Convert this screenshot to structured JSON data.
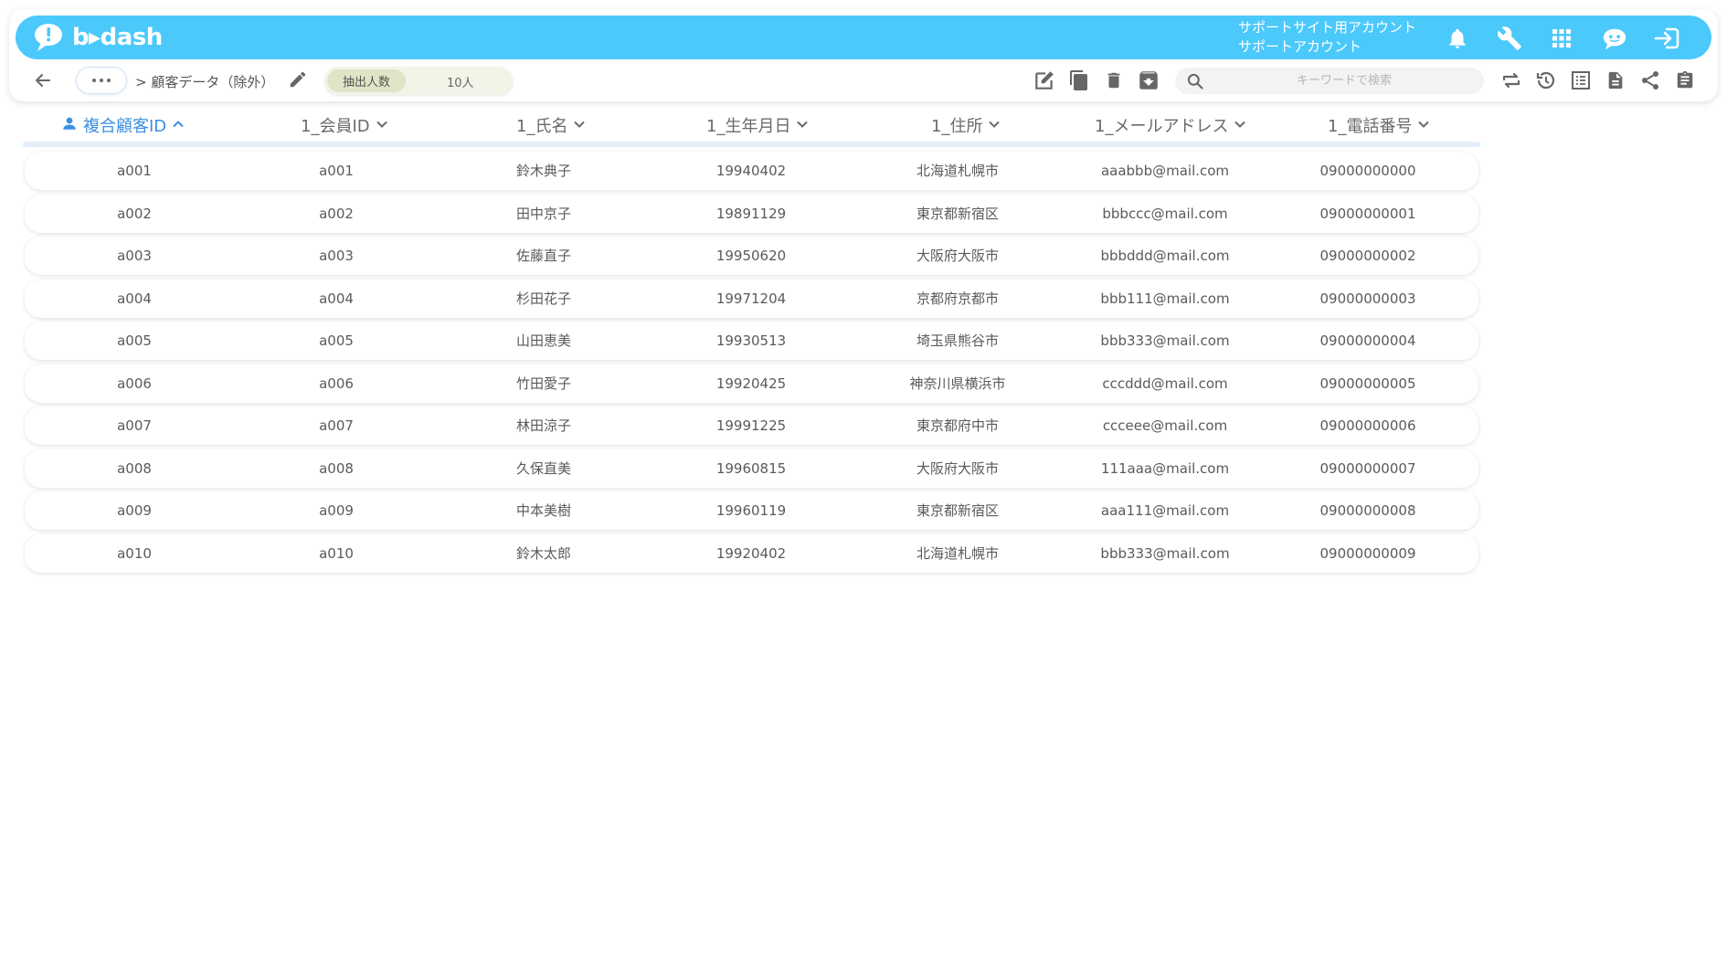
{
  "app": {
    "logo_text": "b▸dash",
    "account_line1": "サポートサイト用アカウント",
    "account_line2": "サポートアカウント",
    "brand_color": "#4cc9fb",
    "accent_color": "#3b8fe0"
  },
  "top_icons": [
    "bell-icon",
    "wrench-icon",
    "apps-grid-icon",
    "chat-bot-icon",
    "logout-icon"
  ],
  "breadcrumb": {
    "separator": ">",
    "current": "顧客データ（除外）"
  },
  "count": {
    "label": "抽出人数",
    "value": "10人"
  },
  "search": {
    "placeholder": "キーワードで検索"
  },
  "toolbar_icons_left": [
    "edit-note-icon",
    "copy-icon",
    "delete-icon",
    "archive-icon"
  ],
  "toolbar_icons_right": [
    "sync-icon",
    "history-icon",
    "list-view-icon",
    "document-icon",
    "share-icon",
    "clipboard-icon"
  ],
  "table": {
    "columns": [
      {
        "label": "複合顧客ID",
        "sort": "asc"
      },
      {
        "label": "1_会員ID",
        "sort": "desc"
      },
      {
        "label": "1_氏名",
        "sort": "desc"
      },
      {
        "label": "1_生年月日",
        "sort": "desc"
      },
      {
        "label": "1_住所",
        "sort": "desc"
      },
      {
        "label": "1_メールアドレス",
        "sort": "desc"
      },
      {
        "label": "1_電話番号",
        "sort": "desc"
      }
    ],
    "rows": [
      [
        "a001",
        "a001",
        "鈴木典子",
        "19940402",
        "北海道札幌市",
        "aaabbb@mail.com",
        "09000000000"
      ],
      [
        "a002",
        "a002",
        "田中京子",
        "19891129",
        "東京都新宿区",
        "bbbccc@mail.com",
        "09000000001"
      ],
      [
        "a003",
        "a003",
        "佐藤直子",
        "19950620",
        "大阪府大阪市",
        "bbbddd@mail.com",
        "09000000002"
      ],
      [
        "a004",
        "a004",
        "杉田花子",
        "19971204",
        "京都府京都市",
        "bbb111@mail.com",
        "09000000003"
      ],
      [
        "a005",
        "a005",
        "山田恵美",
        "19930513",
        "埼玉県熊谷市",
        "bbb333@mail.com",
        "09000000004"
      ],
      [
        "a006",
        "a006",
        "竹田愛子",
        "19920425",
        "神奈川県横浜市",
        "cccddd@mail.com",
        "09000000005"
      ],
      [
        "a007",
        "a007",
        "林田涼子",
        "19991225",
        "東京都府中市",
        "ccceee@mail.com",
        "09000000006"
      ],
      [
        "a008",
        "a008",
        "久保直美",
        "19960815",
        "大阪府大阪市",
        "111aaa@mail.com",
        "09000000007"
      ],
      [
        "a009",
        "a009",
        "中本美樹",
        "19960119",
        "東京都新宿区",
        "aaa111@mail.com",
        "09000000008"
      ],
      [
        "a010",
        "a010",
        "鈴木太郎",
        "19920402",
        "北海道札幌市",
        "bbb333@mail.com",
        "09000000009"
      ]
    ]
  }
}
